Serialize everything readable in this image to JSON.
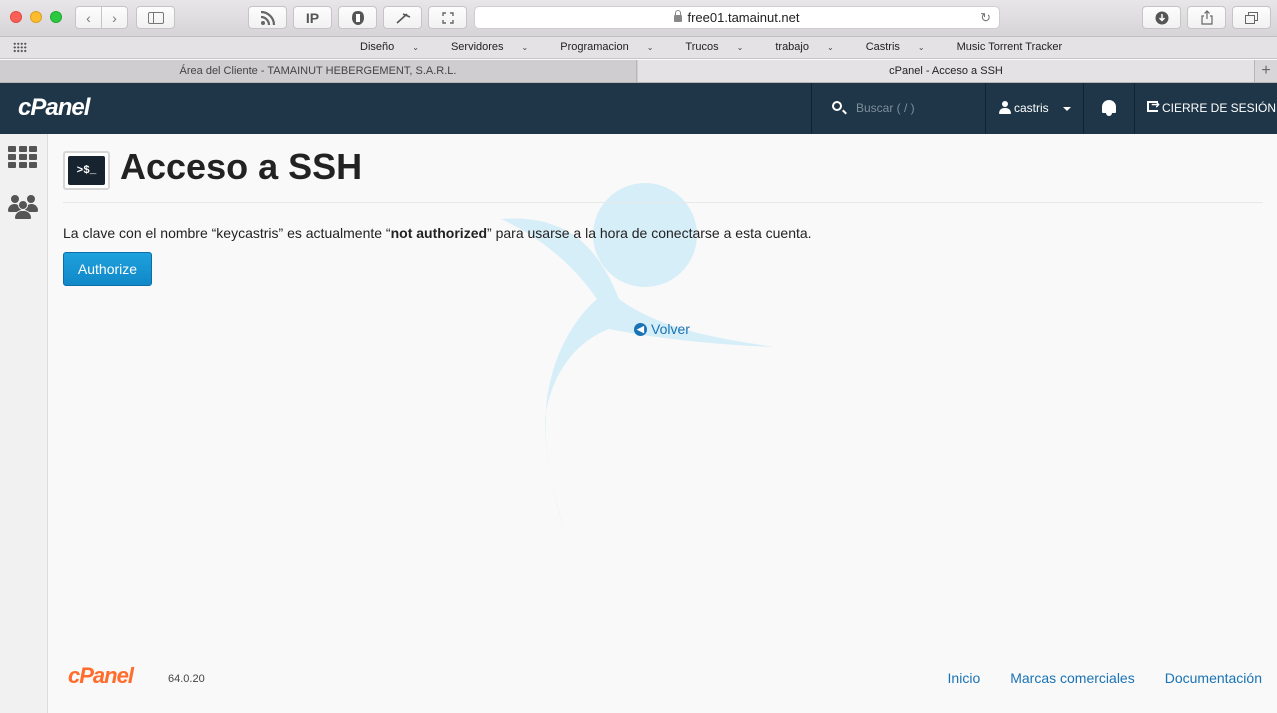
{
  "browser": {
    "url": "free01.tamainut.net",
    "favorites": [
      "Diseño",
      "Servidores",
      "Programacion",
      "Trucos",
      "trabajo",
      "Castris",
      "Music Torrent Tracker"
    ],
    "favorites_with_menu": [
      true,
      true,
      true,
      true,
      true,
      true,
      false
    ],
    "tabs": [
      {
        "title": "Área del Cliente - TAMAINUT HEBERGEMENT, S.A.R.L.",
        "active": false
      },
      {
        "title": "cPanel - Acceso a SSH",
        "active": true
      }
    ],
    "toolbar_icons": [
      "back-icon",
      "forward-icon",
      "sidebar-icon",
      "rss-icon",
      "ip-icon",
      "shield-icon",
      "tool-icon",
      "expand-icon",
      "reload-icon",
      "download-icon",
      "share-icon",
      "tabs-overview-icon",
      "new-tab-icon"
    ]
  },
  "header": {
    "logo": "cPanel",
    "search_placeholder": "Buscar ( / )",
    "username": "castris",
    "logout_label": "CIERRE DE SESIÓN"
  },
  "colors": {
    "header_bg": "#1e3648",
    "accent": "#179bd7",
    "link": "#1a73b5",
    "footer_logo": "#ff6c2c"
  },
  "page": {
    "icon_text": ">$_",
    "title": "Acceso a SSH",
    "message_prefix": "La clave con el nombre “keycastris” es actualmente “",
    "message_status": "not authorized",
    "message_suffix": "” para usarse a la hora de conectarse a esta cuenta.",
    "authorize_label": "Authorize",
    "back_label": "Volver"
  },
  "footer": {
    "logo": "cPanel",
    "version": "64.0.20",
    "links": [
      "Inicio",
      "Marcas comerciales",
      "Documentación"
    ]
  }
}
